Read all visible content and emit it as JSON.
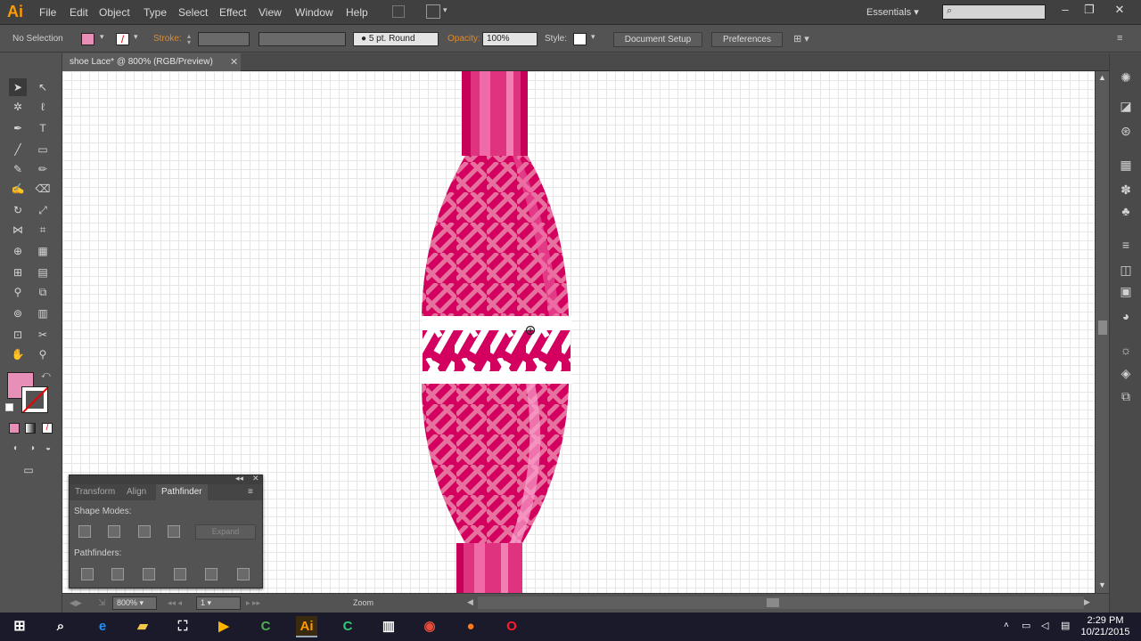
{
  "app": {
    "logo": "Ai",
    "title": "shoe Lace* @ 800% (RGB/Preview)"
  },
  "menu": [
    "File",
    "Edit",
    "Object",
    "Type",
    "Select",
    "Effect",
    "View",
    "Window",
    "Help"
  ],
  "workspace": "Essentials",
  "control": {
    "selection": "No Selection",
    "stroke_label": "Stroke:",
    "brush": "5 pt. Round",
    "opacity_label": "Opacity:",
    "opacity": "100%",
    "style_label": "Style:",
    "doc_setup": "Document Setup",
    "preferences": "Preferences"
  },
  "pathfinder": {
    "tabs": [
      "Transform",
      "Align",
      "Pathfinder"
    ],
    "shape_modes": "Shape Modes:",
    "expand": "Expand",
    "pathfinders": "Pathfinders:"
  },
  "status": {
    "zoom": "800%",
    "artboard": "1",
    "tool": "Zoom"
  },
  "clock": {
    "time": "2:29 PM",
    "date": "10/21/2015"
  },
  "colors": {
    "fill": "#e88fb8",
    "lace": "#d3005f",
    "lace_light": "#f06aa8",
    "accent": "#ff9a00"
  }
}
